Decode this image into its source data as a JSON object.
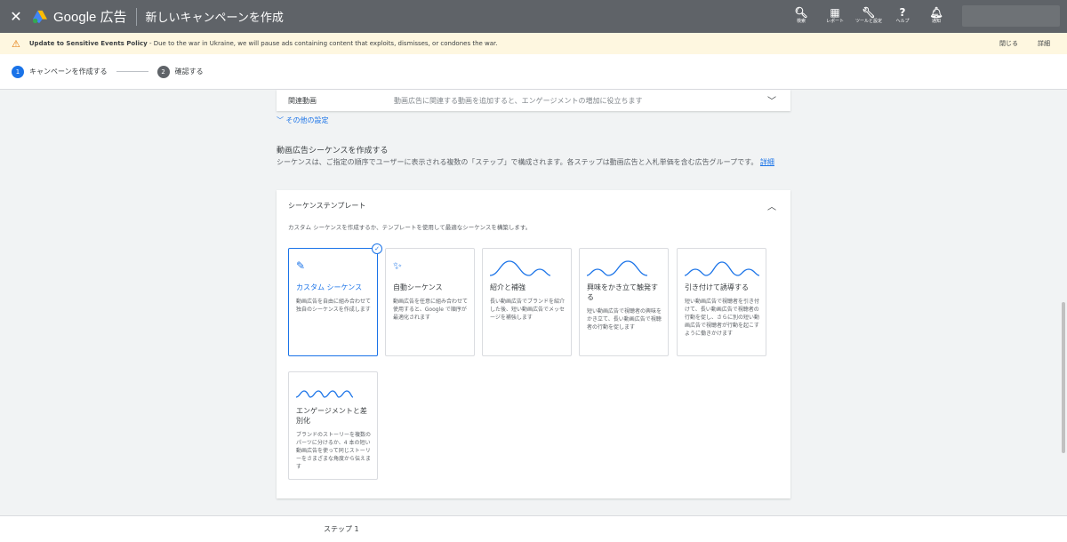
{
  "topbar": {
    "close": "✕",
    "brand": "Google 広告",
    "page_title": "新しいキャンペーンを作成",
    "tools": [
      {
        "icon": "search-icon",
        "glyph": "🔍︎",
        "label": "検索"
      },
      {
        "icon": "report-icon",
        "glyph": "▦",
        "label": "レポート"
      },
      {
        "icon": "wrench-icon",
        "glyph": "🔧︎",
        "label": "ツールと設定"
      },
      {
        "icon": "help-icon",
        "glyph": "?",
        "label": "ヘルプ"
      },
      {
        "icon": "bell-icon",
        "glyph": "🔔︎",
        "label": "通知"
      }
    ]
  },
  "notice": {
    "icon": "warning-icon",
    "title": "Update to Sensitive Events Policy",
    "text": " - Due to the war in Ukraine, we will pause ads containing content that exploits, dismisses, or condones the war.",
    "close": "閉じる",
    "details": "詳細"
  },
  "stepper": {
    "steps": [
      {
        "num": "1",
        "label": "キャンペーンを作成する"
      },
      {
        "num": "2",
        "label": "確認する"
      }
    ]
  },
  "related": {
    "label": "関連動画",
    "desc": "動画広告に関連する動画を追加すると、エンゲージメントの増加に役立ちます"
  },
  "more_settings": "その他の設定",
  "sequence": {
    "title": "動画広告シーケンスを作成する",
    "desc": "シーケンスは、ご指定の順序でユーザーに表示される複数の「ステップ」で構成されます。各ステップは動画広告と入札単価を含む広告グループです。",
    "link": "詳細"
  },
  "template": {
    "header": "シーケンステンプレート",
    "subtitle": "カスタム シーケンスを作成するか、テンプレートを使用して最適なシーケンスを構築します。",
    "cards": [
      {
        "name": "カスタム シーケンス",
        "text": "動画広告を自由に組み合わせて独自のシーケンスを作成します"
      },
      {
        "name": "自動シーケンス",
        "text": "動画広告を任意に組み合わせて使用すると、Google で順序が最適化されます"
      },
      {
        "name": "紹介と補強",
        "text": "長い動画広告でブランドを紹介した後、短い動画広告でメッセージを補強します"
      },
      {
        "name": "興味をかき立て触発する",
        "text": "短い動画広告で視聴者の興味をかき立て、長い動画広告で視聴者の行動を促します"
      },
      {
        "name": "引き付けて誘導する",
        "text": "短い動画広告で視聴者を引き付けて、長い動画広告で視聴者の行動を促し、さらに別の短い動画広告で視聴者が行動を起こすように働きかけます"
      },
      {
        "name": "エンゲージメントと差別化",
        "text": "ブランドのストーリーを複数のパーツに分けるか、4 本の短い動画広告を使って同じストーリーをさまざまな角度から伝えます"
      }
    ]
  },
  "footer": {
    "step": "ステップ 1"
  },
  "colors": {
    "accent": "#1a73e8",
    "topbar": "#5f6368",
    "notice_bg": "#fef7e0",
    "warning": "#e37400"
  }
}
